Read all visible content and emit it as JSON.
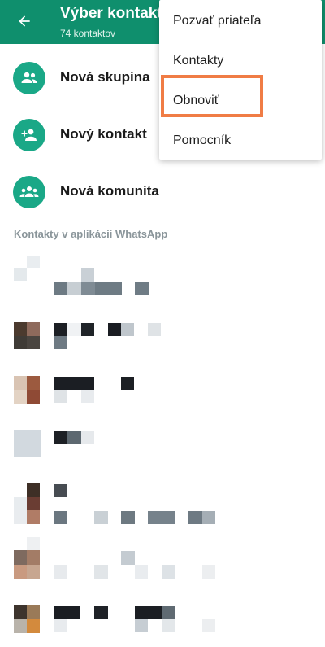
{
  "header": {
    "title": "Výber kontakt",
    "subtitle": "74 kontaktov"
  },
  "actions": [
    {
      "label": "Nová skupina",
      "icon": "group-icon"
    },
    {
      "label": "Nový kontakt",
      "icon": "add-person-icon"
    },
    {
      "label": "Nová komunita",
      "icon": "community-icon"
    }
  ],
  "section": {
    "contacts_label": "Kontakty v aplikácii WhatsApp"
  },
  "menu": {
    "items": [
      {
        "label": "Pozvať priateľa"
      },
      {
        "label": "Kontakty"
      },
      {
        "label": "Obnoviť",
        "highlighted": true
      },
      {
        "label": "Pomocník"
      }
    ]
  },
  "colors": {
    "appbar": "#0f8f6d",
    "accent": "#1aa887",
    "highlight": "#f07c45"
  }
}
